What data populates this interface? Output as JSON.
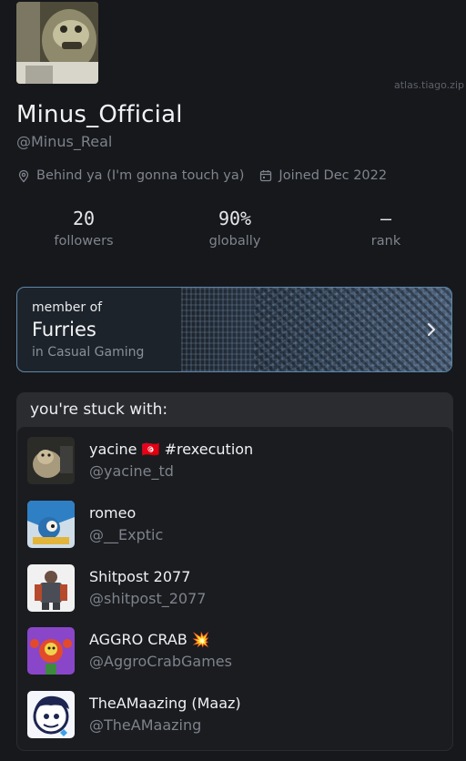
{
  "watermark": "atlas.tiago.zip",
  "profile": {
    "display_name": "Minus_Official",
    "handle": "@Minus_Real",
    "location": "Behind ya (I'm gonna touch ya)",
    "joined": "Joined Dec 2022",
    "avatar_icon": "profile-avatar-image"
  },
  "stats": [
    {
      "value": "20",
      "label": "followers"
    },
    {
      "value": "90%",
      "label": "globally"
    },
    {
      "value": "—",
      "label": "rank"
    }
  ],
  "membership": {
    "label": "member of",
    "community": "Furries",
    "subtitle": "in Casual Gaming",
    "accent": "#5f87aa"
  },
  "stuck_with": {
    "title": "you're stuck with:",
    "users": [
      {
        "name": "yacine 🇹🇳 #rexecution",
        "handle": "@yacine_td"
      },
      {
        "name": "romeo",
        "handle": "@__Exptic"
      },
      {
        "name": "Shitpost 2077",
        "handle": "@shitpost_2077"
      },
      {
        "name": "AGGRO CRAB 💥",
        "handle": "@AggroCrabGames"
      },
      {
        "name": "TheAMaazing (Maaz)",
        "handle": "@TheAMaazing"
      }
    ]
  },
  "colors": {
    "background": "#16181c",
    "card": "#2a2c30",
    "muted_text": "#80858d"
  }
}
